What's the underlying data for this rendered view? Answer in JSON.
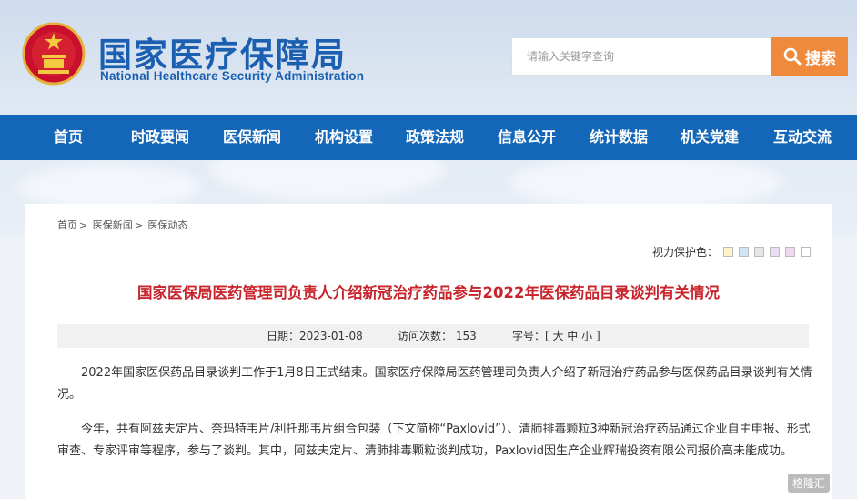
{
  "header": {
    "title_zh": "国家医疗保障局",
    "title_en": "National Healthcare Security Administration",
    "search_placeholder": "请输入关键字查询",
    "search_button": "搜索"
  },
  "nav": {
    "items": [
      {
        "label": "首页"
      },
      {
        "label": "时政要闻"
      },
      {
        "label": "医保新闻"
      },
      {
        "label": "机构设置"
      },
      {
        "label": "政策法规"
      },
      {
        "label": "信息公开"
      },
      {
        "label": "统计数据"
      },
      {
        "label": "机关党建"
      },
      {
        "label": "互动交流"
      }
    ]
  },
  "breadcrumb": {
    "items": [
      "首页",
      "医保新闻",
      "医保动态"
    ],
    "sep": ">"
  },
  "eye_protect": {
    "label": "视力保护色：",
    "colors": [
      "#fdf3c6",
      "#cfe6f6",
      "#e6e6e6",
      "#eadcf2",
      "#f0d8ee",
      "#ffffff"
    ]
  },
  "article": {
    "title": "国家医保局医药管理司负责人介绍新冠治疗药品参与2022年医保药品目录谈判有关情况",
    "date": "日期：2023-01-08",
    "visits": "访问次数：  153",
    "font_size": "字号：[ 大 中 小 ]",
    "paragraphs": [
      "2022年国家医保药品目录谈判工作于1月8日正式结束。国家医疗保障局医药管理司负责人介绍了新冠治疗药品参与医保药品目录谈判有关情况。",
      "今年，共有阿兹夫定片、奈玛特韦片/利托那韦片组合包装（下文简称“Paxlovid”）、清肺排毒颗粒3种新冠治疗药品通过企业自主申报、形式审查、专家评审等程序，参与了谈判。其中，阿兹夫定片、清肺排毒颗粒谈判成功，Paxlovid因生产企业辉瑞投资有限公司报价高未能成功。"
    ]
  },
  "watermark": "格隆汇",
  "colors": {
    "brand_blue": "#1467b8",
    "title_red": "#c9232b",
    "search_orange": "#ef8a3c"
  }
}
